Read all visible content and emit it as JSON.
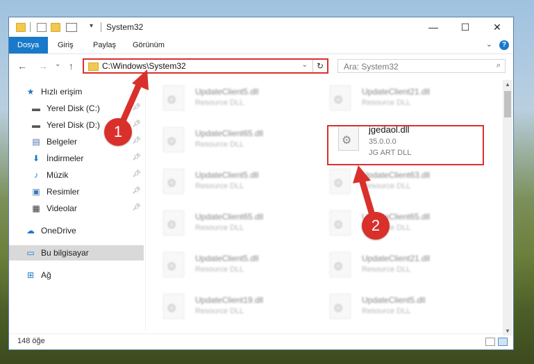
{
  "window": {
    "title": "System32",
    "controls": {
      "minimize": "—",
      "maximize": "☐",
      "close": "✕"
    }
  },
  "ribbon": {
    "tabs": [
      "Dosya",
      "Giriş",
      "Paylaş",
      "Görünüm"
    ],
    "help": "?"
  },
  "address": {
    "path": "C:\\Windows\\System32",
    "search_placeholder": "Ara: System32"
  },
  "sidebar": {
    "items": [
      {
        "label": "Hızlı erişim",
        "icon": "star-icon"
      },
      {
        "label": "Yerel Disk (C:)",
        "icon": "drive-icon",
        "pinned": true
      },
      {
        "label": "Yerel Disk (D:)",
        "icon": "drive-icon",
        "pinned": true
      },
      {
        "label": "Belgeler",
        "icon": "documents-icon",
        "pinned": true
      },
      {
        "label": "İndirmeler",
        "icon": "download-icon",
        "pinned": true
      },
      {
        "label": "Müzik",
        "icon": "music-icon",
        "pinned": true
      },
      {
        "label": "Resimler",
        "icon": "pictures-icon",
        "pinned": true
      },
      {
        "label": "Videolar",
        "icon": "videos-icon",
        "pinned": true
      },
      {
        "label": "OneDrive",
        "icon": "onedrive-icon"
      },
      {
        "label": "Bu bilgisayar",
        "icon": "computer-icon",
        "selected": true
      },
      {
        "label": "Ağ",
        "icon": "network-icon"
      }
    ]
  },
  "files": {
    "left": [
      {
        "name": "UpdateClient5.dll",
        "desc": "Resource DLL"
      },
      {
        "name": "UpdateClient65.dll",
        "desc": "Resource DLL"
      },
      {
        "name": "UpdateClient5.dll",
        "desc": "Resource DLL"
      },
      {
        "name": "UpdateClient65.dll",
        "desc": "Resource DLL"
      },
      {
        "name": "UpdateClient5.dll",
        "desc": "Resource DLL"
      },
      {
        "name": "UpdateClient19.dll",
        "desc": "Resource DLL"
      }
    ],
    "right": [
      {
        "name": "UpdateClient21.dll",
        "desc": "Resource DLL"
      },
      {
        "name": "UpdateClient63.dll",
        "desc": "Resource DLL"
      },
      {
        "name": "UpdateClient65.dll",
        "desc": "Resource DLL"
      },
      {
        "name": "UpdateClient21.dll",
        "desc": "Resource DLL"
      },
      {
        "name": "UpdateClient5.dll",
        "desc": "Resource DLL"
      }
    ],
    "highlighted": {
      "name": "jgedaol.dll",
      "version": "35.0.0.0",
      "desc": "JG ART DLL"
    }
  },
  "status": {
    "count": "148 öğe"
  },
  "callouts": [
    "1",
    "2"
  ],
  "colors": {
    "accent": "#1979ca",
    "highlight": "#d9302c"
  }
}
